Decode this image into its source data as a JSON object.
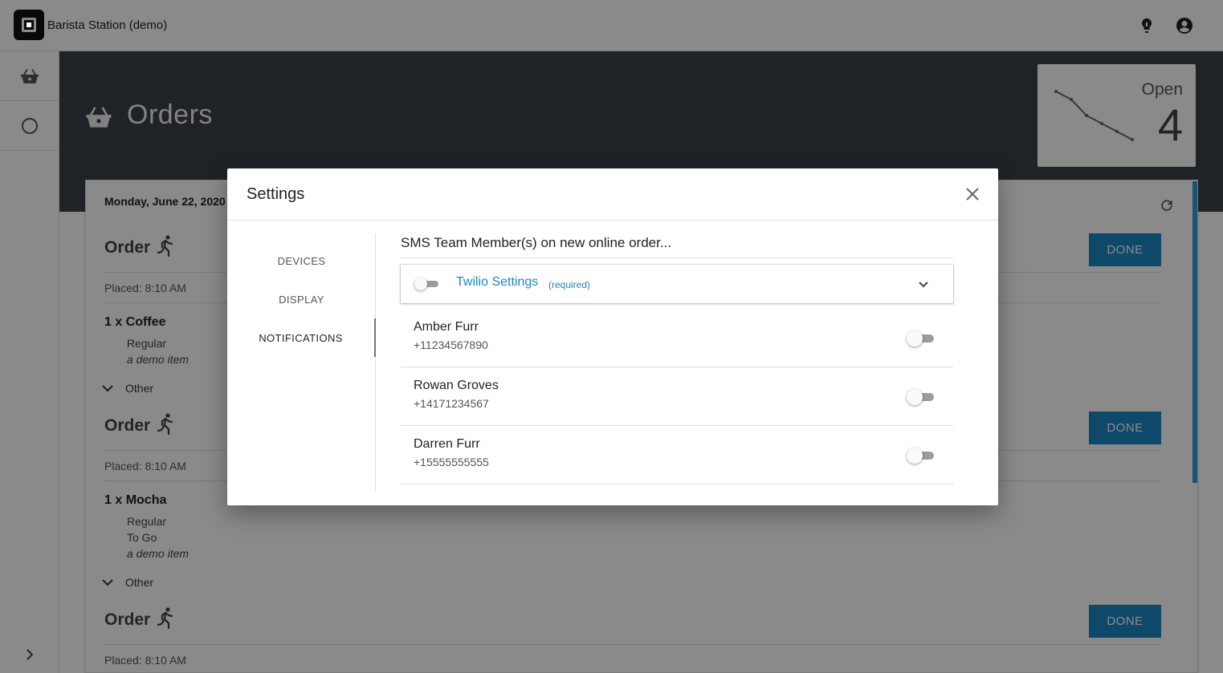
{
  "app": {
    "title": "Barista Station (demo)"
  },
  "header": {
    "title": "Orders",
    "open_label": "Open",
    "open_count": "4"
  },
  "orders": {
    "date": "Monday, June 22, 2020",
    "list": [
      {
        "title": "Order",
        "placed": "Placed: 8:10 AM",
        "done_label": "DONE",
        "item": "1 x Coffee",
        "modifiers": [
          "Regular"
        ],
        "note": "a demo item",
        "other_label": "Other"
      },
      {
        "title": "Order",
        "placed": "Placed: 8:10 AM",
        "done_label": "DONE",
        "item": "1 x Mocha",
        "modifiers": [
          "Regular",
          "To Go"
        ],
        "note": "a demo item",
        "other_label": "Other"
      },
      {
        "title": "Order",
        "placed": "Placed: 8:10 AM",
        "done_label": "DONE"
      }
    ]
  },
  "settings": {
    "title": "Settings",
    "nav": [
      {
        "label": "DEVICES",
        "active": false
      },
      {
        "label": "DISPLAY",
        "active": false
      },
      {
        "label": "NOTIFICATIONS",
        "active": true
      }
    ],
    "section_heading": "SMS Team Member(s) on new online order...",
    "twilio": {
      "label": "Twilio Settings",
      "required": "(required)",
      "enabled": false,
      "expanded": false
    },
    "members": [
      {
        "name": "Amber Furr",
        "phone": "+11234567890",
        "enabled": false
      },
      {
        "name": "Rowan Groves",
        "phone": "+14171234567",
        "enabled": false
      },
      {
        "name": "Darren Furr",
        "phone": "+15555555555",
        "enabled": false
      }
    ]
  },
  "colors": {
    "accent": "#1a87c5",
    "header_bg": "#3a3f48",
    "scroll_accent": "#2d9ad5"
  },
  "icons": {
    "topbar": [
      "lightbulb-icon",
      "account-circle-icon"
    ],
    "rail": [
      "basket-icon",
      "history-icon",
      "chevron-right-icon"
    ],
    "order": "runner-icon"
  }
}
